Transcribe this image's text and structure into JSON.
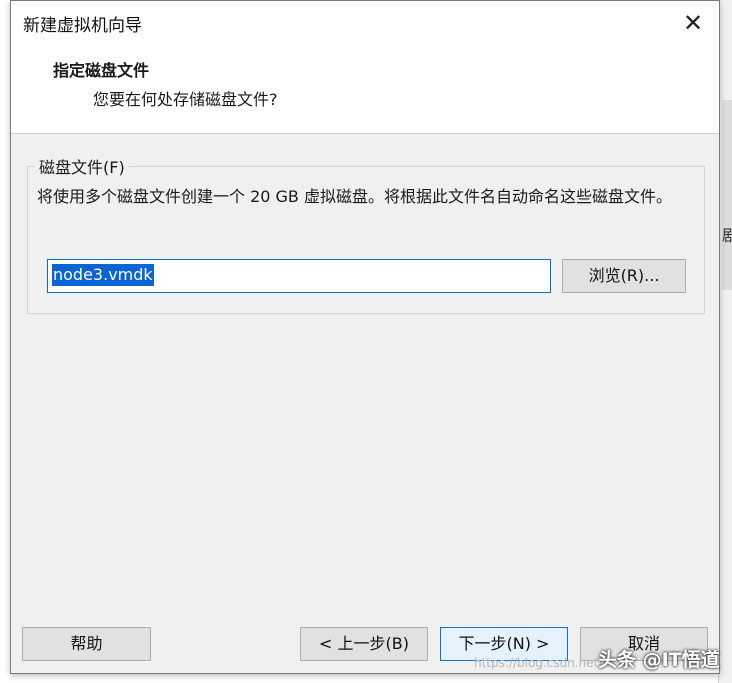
{
  "window": {
    "title": "新建虚拟机向导",
    "close_glyph": "✕"
  },
  "header": {
    "title": "指定磁盘文件",
    "subtitle": "您要在何处存储磁盘文件?"
  },
  "disk_file_group": {
    "label": "磁盘文件(F)",
    "description": "将使用多个磁盘文件创建一个 20 GB 虚拟磁盘。将根据此文件名自动命名这些磁盘文件。",
    "file_name_value": "node3.vmdk",
    "browse_label": "浏览(R)..."
  },
  "footer": {
    "help_label": "帮助",
    "back_label": "< 上一步(B)",
    "next_label": "下一步(N) >",
    "cancel_label": "取消"
  },
  "overlay": {
    "url_watermark": "https://blog.csdn.net/...",
    "brand_watermark": "头条 @IT悟道"
  },
  "background_window": {
    "partial_char": "剧"
  },
  "colors": {
    "dialog_bg": "#f0f0f0",
    "header_bg": "#ffffff",
    "selection": "#0a64d6",
    "focus_border": "#0078d7"
  }
}
